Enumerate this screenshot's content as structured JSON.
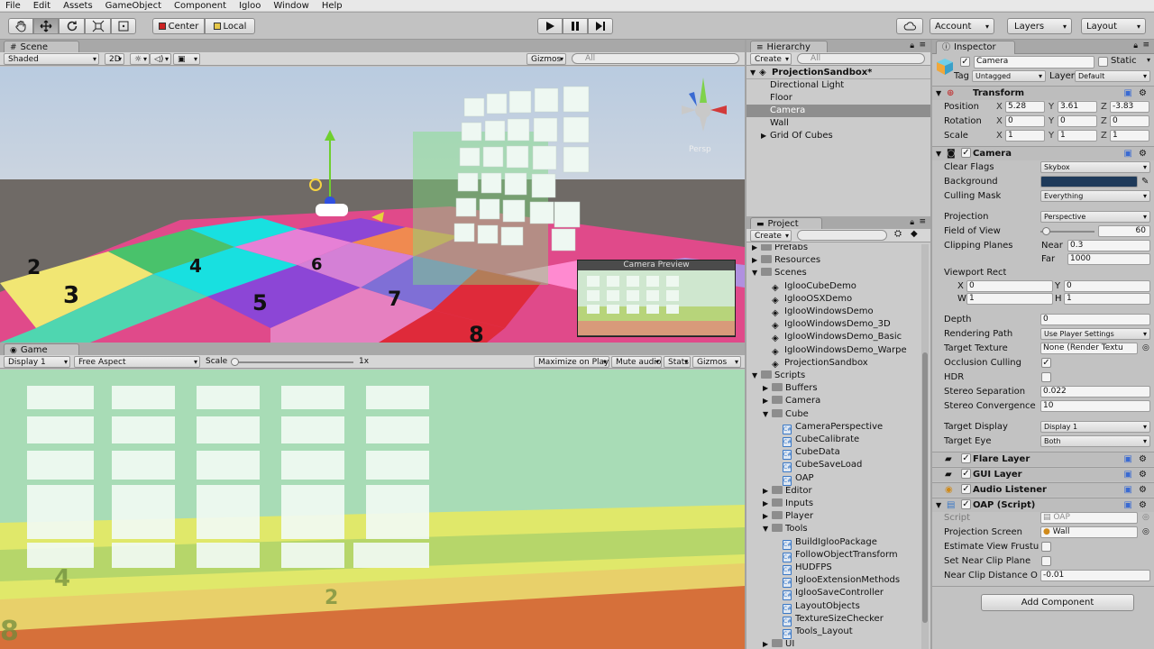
{
  "menu": [
    "File",
    "Edit",
    "Assets",
    "GameObject",
    "Component",
    "Igloo",
    "Window",
    "Help"
  ],
  "toolbar": {
    "center": "Center",
    "local": "Local",
    "account": "Account",
    "layers": "Layers",
    "layout": "Layout"
  },
  "scene": {
    "tab": "Scene",
    "shading": "Shaded",
    "mode2d": "2D",
    "gizmos": "Gizmos",
    "search_placeholder": "All",
    "persp": "Persp",
    "camera_preview": "Camera Preview"
  },
  "game": {
    "tab": "Game",
    "display": "Display 1",
    "aspect": "Free Aspect",
    "scale_label": "Scale",
    "scale_value": "1x",
    "scale_fraction": 0.0,
    "maximize": "Maximize on Play",
    "mute": "Mute audio",
    "stats": "Stats",
    "gizmos": "Gizmos"
  },
  "hierarchy": {
    "tab": "Hierarchy",
    "create": "Create",
    "search_placeholder": "All",
    "root": "ProjectionSandbox*",
    "items": [
      "Directional Light",
      "Floor",
      "Camera",
      "Wall",
      "Grid Of Cubes"
    ],
    "selected_index": 2
  },
  "project": {
    "tab": "Project",
    "create": "Create",
    "items": [
      {
        "label": "Prefabs",
        "kind": "folder",
        "depth": 1,
        "arrow": "right"
      },
      {
        "label": "Resources",
        "kind": "folder",
        "depth": 1,
        "arrow": "right"
      },
      {
        "label": "Scenes",
        "kind": "folder",
        "depth": 1,
        "arrow": "down"
      },
      {
        "label": "IglooCubeDemo",
        "kind": "scene",
        "depth": 2,
        "arrow": ""
      },
      {
        "label": "IglooOSXDemo",
        "kind": "scene",
        "depth": 2,
        "arrow": ""
      },
      {
        "label": "IglooWindowsDemo",
        "kind": "scene",
        "depth": 2,
        "arrow": ""
      },
      {
        "label": "IglooWindowsDemo_3D",
        "kind": "scene",
        "depth": 2,
        "arrow": ""
      },
      {
        "label": "IglooWindowsDemo_Basic",
        "kind": "scene",
        "depth": 2,
        "arrow": ""
      },
      {
        "label": "IglooWindowsDemo_Warpe",
        "kind": "scene",
        "depth": 2,
        "arrow": ""
      },
      {
        "label": "ProjectionSandbox",
        "kind": "scene",
        "depth": 2,
        "arrow": ""
      },
      {
        "label": "Scripts",
        "kind": "folder",
        "depth": 1,
        "arrow": "down"
      },
      {
        "label": "Buffers",
        "kind": "folder",
        "depth": 2,
        "arrow": "right"
      },
      {
        "label": "Camera",
        "kind": "folder",
        "depth": 2,
        "arrow": "right"
      },
      {
        "label": "Cube",
        "kind": "folder",
        "depth": 2,
        "arrow": "down"
      },
      {
        "label": "CameraPerspective",
        "kind": "script",
        "depth": 3,
        "arrow": ""
      },
      {
        "label": "CubeCalibrate",
        "kind": "script",
        "depth": 3,
        "arrow": ""
      },
      {
        "label": "CubeData",
        "kind": "script",
        "depth": 3,
        "arrow": ""
      },
      {
        "label": "CubeSaveLoad",
        "kind": "script",
        "depth": 3,
        "arrow": ""
      },
      {
        "label": "OAP",
        "kind": "script",
        "depth": 3,
        "arrow": ""
      },
      {
        "label": "Editor",
        "kind": "folder",
        "depth": 2,
        "arrow": "right"
      },
      {
        "label": "Inputs",
        "kind": "folder",
        "depth": 2,
        "arrow": "right"
      },
      {
        "label": "Player",
        "kind": "folder",
        "depth": 2,
        "arrow": "right"
      },
      {
        "label": "Tools",
        "kind": "folder",
        "depth": 2,
        "arrow": "down"
      },
      {
        "label": "BuildIglooPackage",
        "kind": "script",
        "depth": 3,
        "arrow": ""
      },
      {
        "label": "FollowObjectTransform",
        "kind": "script",
        "depth": 3,
        "arrow": ""
      },
      {
        "label": "HUDFPS",
        "kind": "script",
        "depth": 3,
        "arrow": ""
      },
      {
        "label": "IglooExtensionMethods",
        "kind": "script",
        "depth": 3,
        "arrow": ""
      },
      {
        "label": "IglooSaveController",
        "kind": "script",
        "depth": 3,
        "arrow": ""
      },
      {
        "label": "LayoutObjects",
        "kind": "script",
        "depth": 3,
        "arrow": ""
      },
      {
        "label": "TextureSizeChecker",
        "kind": "script",
        "depth": 3,
        "arrow": ""
      },
      {
        "label": "Tools_Layout",
        "kind": "script",
        "depth": 3,
        "arrow": ""
      },
      {
        "label": "UI",
        "kind": "folder",
        "depth": 2,
        "arrow": "right"
      }
    ]
  },
  "inspector": {
    "tab": "Inspector",
    "name": "Camera",
    "static_label": "Static",
    "tag_label": "Tag",
    "tag": "Untagged",
    "layer_label": "Layer",
    "layer": "Default",
    "transform": {
      "title": "Transform",
      "rows": [
        {
          "label": "Position",
          "x": "5.28",
          "y": "3.61",
          "z": "-3.83"
        },
        {
          "label": "Rotation",
          "x": "0",
          "y": "0",
          "z": "0"
        },
        {
          "label": "Scale",
          "x": "1",
          "y": "1",
          "z": "1"
        }
      ]
    },
    "camera": {
      "title": "Camera",
      "clear_flags_label": "Clear Flags",
      "clear_flags": "Skybox",
      "background_label": "Background",
      "background_color": "#1e3a5a",
      "culling_mask_label": "Culling Mask",
      "culling_mask": "Everything",
      "projection_label": "Projection",
      "projection": "Perspective",
      "fov_label": "Field of View",
      "fov": "60",
      "fov_fraction": 0.1,
      "clipping_label": "Clipping Planes",
      "near_label": "Near",
      "near": "0.3",
      "far_label": "Far",
      "far": "1000",
      "viewport_label": "Viewport Rect",
      "vx": "0",
      "vy": "0",
      "vw": "1",
      "vh": "1",
      "depth_label": "Depth",
      "depth": "0",
      "rendering_path_label": "Rendering Path",
      "rendering_path": "Use Player Settings",
      "target_texture_label": "Target Texture",
      "target_texture": "None (Render Textu",
      "occlusion_label": "Occlusion Culling",
      "occlusion": true,
      "hdr_label": "HDR",
      "hdr": false,
      "stereo_sep_label": "Stereo Separation",
      "stereo_sep": "0.022",
      "stereo_conv_label": "Stereo Convergence",
      "stereo_conv": "10",
      "target_display_label": "Target Display",
      "target_display": "Display 1",
      "target_eye_label": "Target Eye",
      "target_eye": "Both"
    },
    "flare_layer": "Flare Layer",
    "gui_layer": "GUI Layer",
    "audio_listener": "Audio Listener",
    "oap": {
      "title": "OAP (Script)",
      "script_label": "Script",
      "script": "OAP",
      "projection_screen_label": "Projection Screen",
      "projection_screen": "Wall",
      "estimate_label": "Estimate View Frustu",
      "set_near_label": "Set Near Clip Plane",
      "near_clip_label": "Near Clip Distance O",
      "near_clip": "-0.01"
    },
    "add_component": "Add Component"
  }
}
